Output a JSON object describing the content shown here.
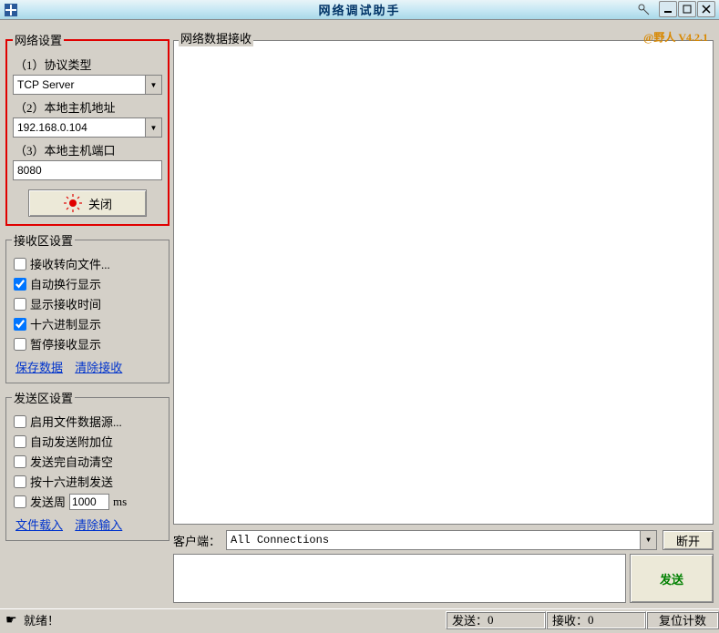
{
  "title": "网络调试助手",
  "brand": "@野人 V4.2.1",
  "groups": {
    "net": {
      "legend": "网络设置",
      "protocol_label": "（1）协议类型",
      "protocol_value": "TCP Server",
      "host_label": "（2）本地主机地址",
      "host_value": "192.168.0.104",
      "port_label": "（3）本地主机端口",
      "port_value": "8080",
      "close_btn": "关闭"
    },
    "recvcfg": {
      "legend": "接收区设置",
      "opts": {
        "to_file": "接收转向文件...",
        "auto_wrap": "自动换行显示",
        "show_time": "显示接收时间",
        "hex": "十六进制显示",
        "pause": "暂停接收显示"
      },
      "save_link": "保存数据",
      "clear_link": "清除接收"
    },
    "sendcfg": {
      "legend": "发送区设置",
      "opts": {
        "file_src": "启用文件数据源...",
        "auto_suffix": "自动发送附加位",
        "auto_clear": "发送完自动清空",
        "hex_send": "按十六进制发送",
        "period_label": "发送周",
        "period_value": "1000",
        "period_unit": "ms"
      },
      "file_link": "文件载入",
      "clear_link": "清除输入"
    }
  },
  "right": {
    "recv_label": "网络数据接收",
    "client_label": "客户端：",
    "client_value": "All Connections",
    "disconnect_btn": "断开",
    "send_btn": "发送"
  },
  "status": {
    "ready": "就绪！",
    "send_count_label": "发送：",
    "send_count_value": "0",
    "recv_count_label": "接收：",
    "recv_count_value": "0",
    "reset_btn": "复位计数"
  }
}
